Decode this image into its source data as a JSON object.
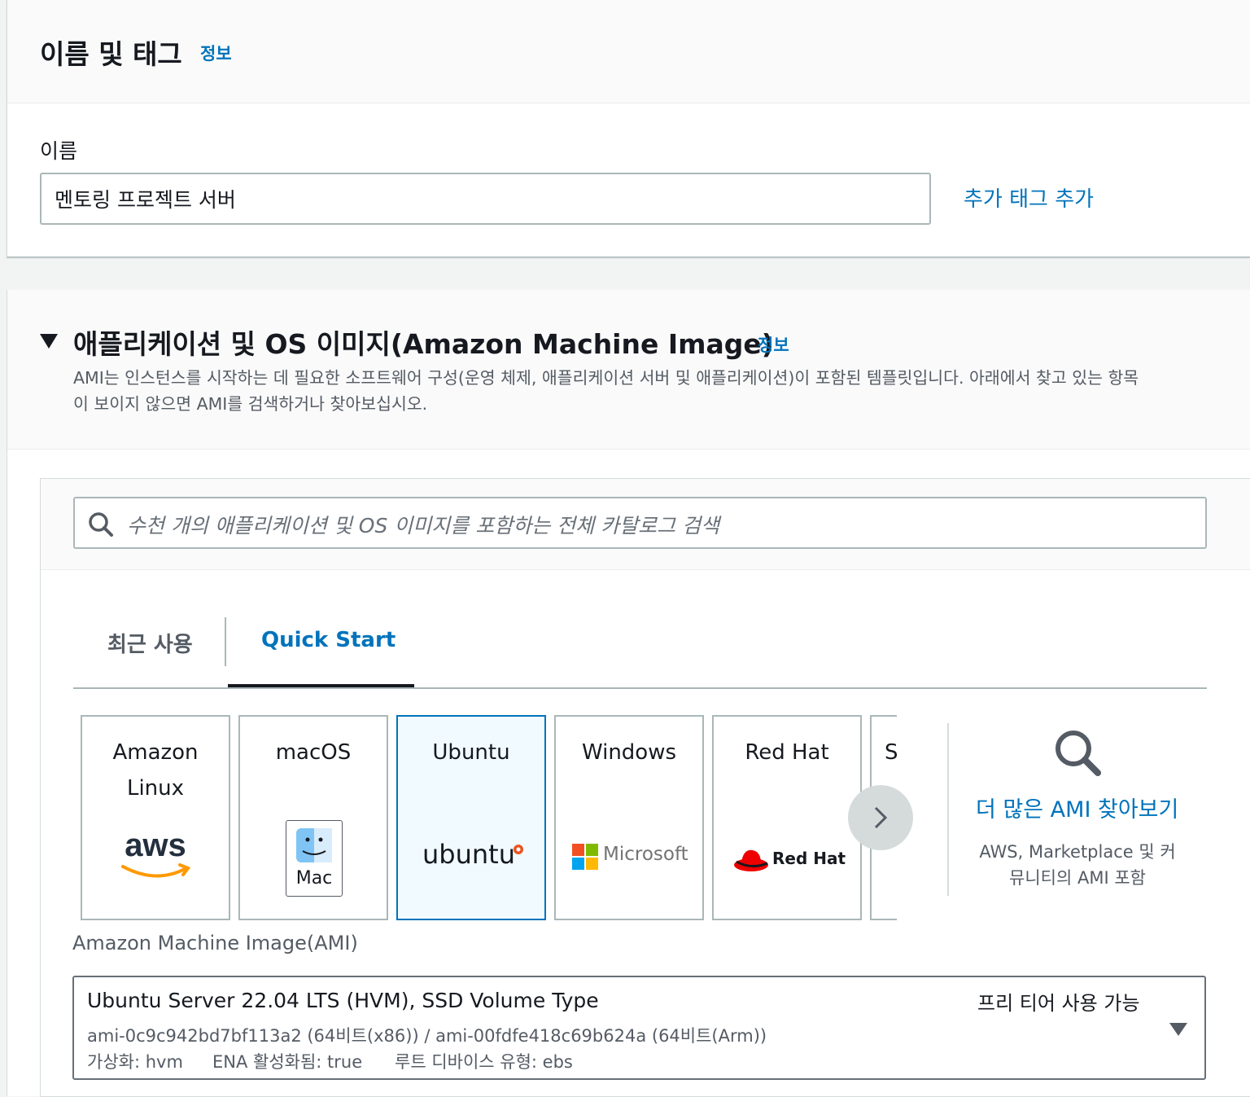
{
  "name_section": {
    "title": "이름 및 태그",
    "info": "정보",
    "name_label": "이름",
    "name_value": "멘토링 프로젝트 서버",
    "add_tag": "추가 태그 추가"
  },
  "ami_section": {
    "title": "애플리케이션 및 OS 이미지(Amazon Machine Image)",
    "info": "정보",
    "desc_line1": "AMI는 인스턴스를 시작하는 데 필요한 소프트웨어 구성(운영 체제, 애플리케이션 서버 및 애플리케이션)이 포함된 템플릿입니다. 아래에서 찾고 있는 항목",
    "desc_line2": "이 보이지 않으면 AMI를 검색하거나 찾아보십시오.",
    "search_placeholder": "수천 개의 애플리케이션 및 OS 이미지를 포함하는 전체 카탈로그 검색",
    "tabs": [
      "최근 사용",
      "Quick Start"
    ],
    "tiles": [
      {
        "name_line1": "Amazon",
        "name_line2": "Linux",
        "logo_text": "aws"
      },
      {
        "name_line1": "macOS",
        "logo_text": "Mac"
      },
      {
        "name_line1": "Ubuntu",
        "logo_text": "ubuntu"
      },
      {
        "name_line1": "Windows",
        "logo_text": "Microsoft"
      },
      {
        "name_line1": "Red Hat",
        "logo_text": "Red Hat"
      },
      {
        "name_line1": "S"
      }
    ],
    "browse_more": "더 많은 AMI 찾아보기",
    "browse_sub_line1": "AWS, Marketplace 및 커",
    "browse_sub_line2": "뮤니티의 AMI 포함",
    "ami_label": "Amazon Machine Image(AMI)",
    "selected_ami": {
      "title": "Ubuntu Server 22.04 LTS (HVM), SSD Volume Type",
      "ids": "ami-0c9c942bd7bf113a2 (64비트(x86)) / ami-00fdfe418c69b624a (64비트(Arm))",
      "virt": "가상화: hvm",
      "ena": "ENA 활성화됨: true",
      "root": "루트 디바이스 유형: ebs",
      "badge": "프리 티어 사용 가능"
    }
  },
  "colors": {
    "link": "#0073bb",
    "selected_tile_bg": "#f1faff",
    "tab_active_border": "#16191f"
  }
}
